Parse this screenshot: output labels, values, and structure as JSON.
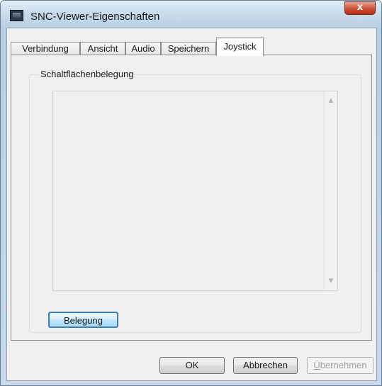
{
  "window": {
    "title": "SNC-Viewer-Eigenschaften",
    "close_label": "x",
    "app_icon": "camera-app-icon"
  },
  "tabs": [
    {
      "label": "Verbindung",
      "active": false
    },
    {
      "label": "Ansicht",
      "active": false
    },
    {
      "label": "Audio",
      "active": false
    },
    {
      "label": "Speichern",
      "active": false
    },
    {
      "label": "Joystick",
      "active": true
    }
  ],
  "joystick_panel": {
    "group_label": "Schaltflächenbelegung",
    "assign_button": "Belegung"
  },
  "footer": {
    "ok_label": "OK",
    "cancel_label": "Abbrechen",
    "apply_label_first": "Ü",
    "apply_label_rest": "bernehmen"
  },
  "colors": {
    "accent_button_border": "#3c7fb1",
    "close_button": "#c63c22"
  }
}
